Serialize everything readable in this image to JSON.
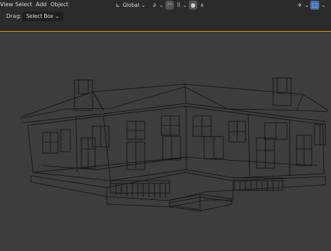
{
  "menus": [
    "View",
    "Select",
    "Add",
    "Object"
  ],
  "header": {
    "drag_label": "Drag:",
    "drag_value": "Select Box"
  },
  "orientation": {
    "label": "Global"
  },
  "colors": {
    "background": "#3d3d3d",
    "header": "#2b2b2b",
    "accent": "#4772b3",
    "active_border": "#d9a21a",
    "wire": "#0e0e0e"
  },
  "icons": [
    "transform-orientation-icon",
    "pivot-icon",
    "snap-magnet-icon",
    "snap-grid-icon",
    "proportional-edit-icon",
    "falloff-icon",
    "overlay-icon",
    "xray-toggle-icon"
  ]
}
